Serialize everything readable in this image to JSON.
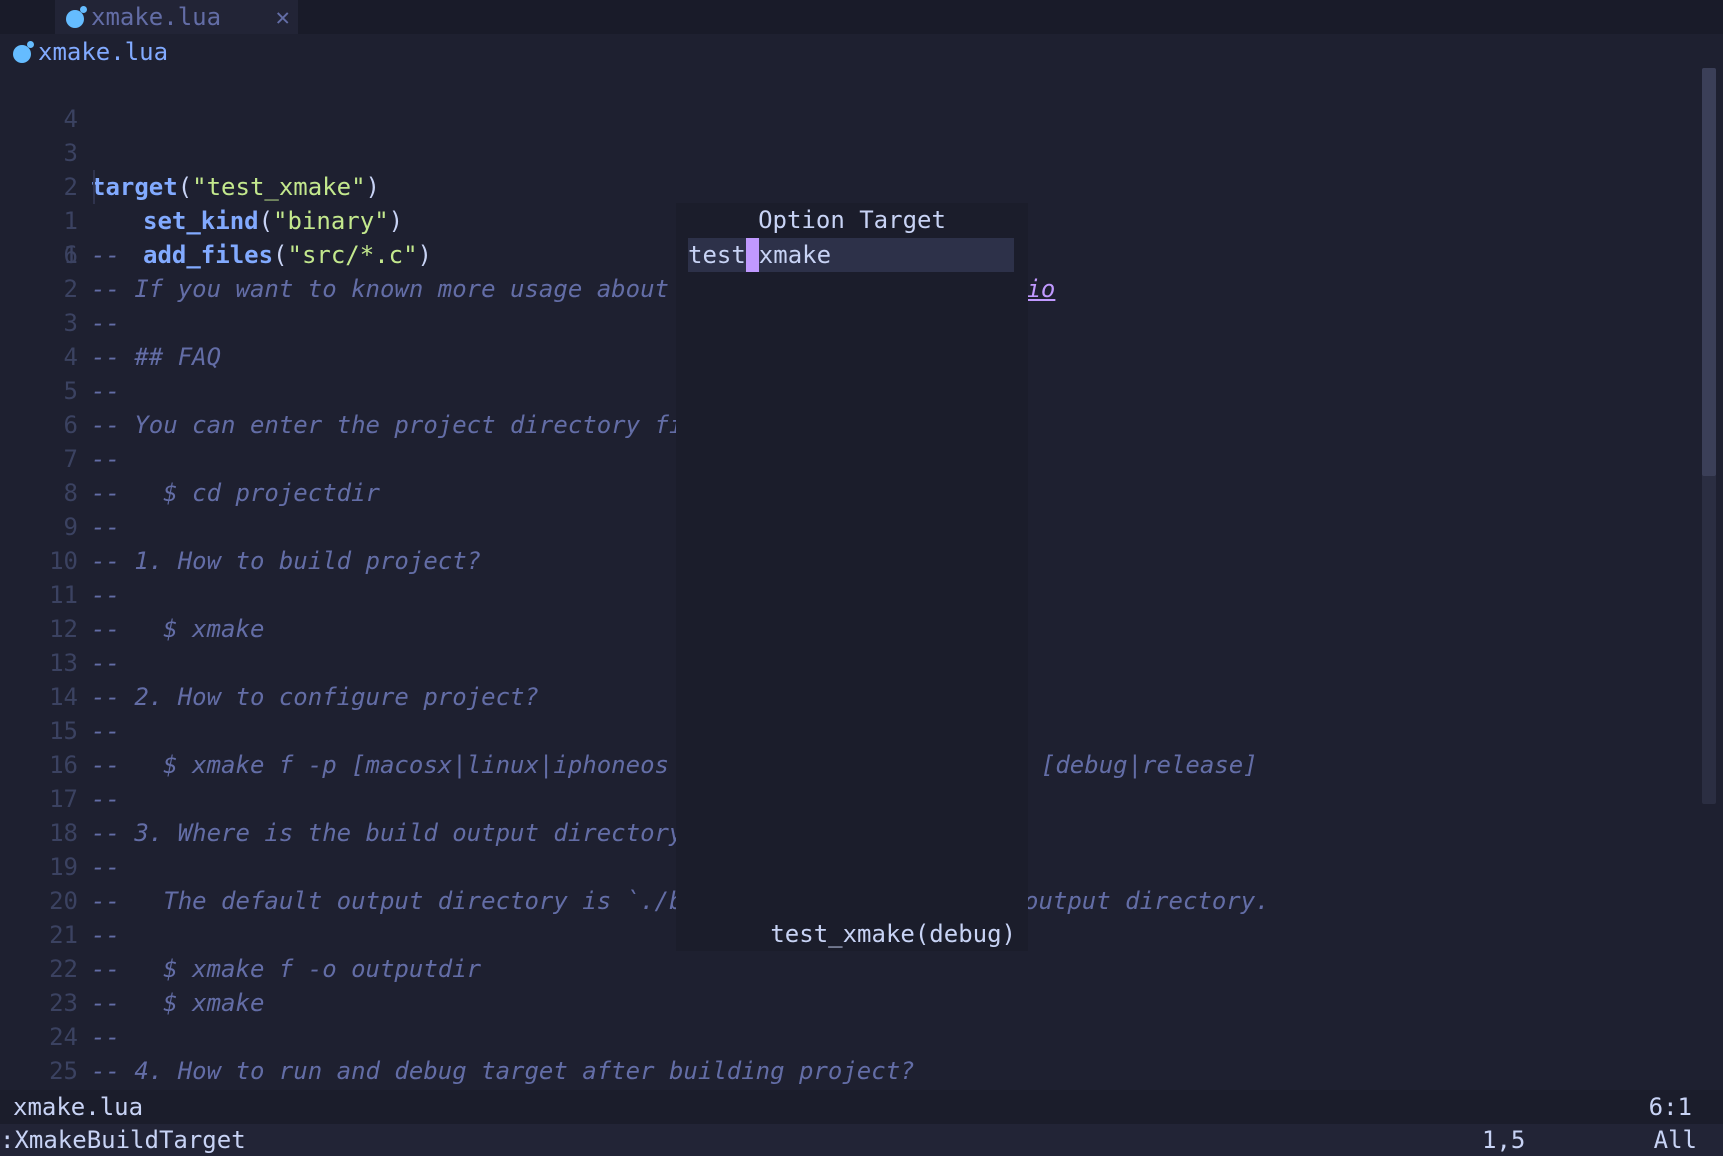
{
  "tab": {
    "title": "xmake.lua",
    "close": "✕"
  },
  "winbar": {
    "filename": "xmake.lua"
  },
  "code": {
    "line4": {
      "num": "4"
    },
    "line3": {
      "num": "3",
      "fn": "target",
      "open": "(",
      "str": "\"test_xmake\"",
      "close": ")"
    },
    "line2": {
      "num": "2",
      "fn": "set_kind",
      "open": "(",
      "str": "\"binary\"",
      "close": ")"
    },
    "line1": {
      "num": "1",
      "fn": "add_files",
      "open": "(",
      "str": "\"src/*.c\"",
      "close": ")"
    },
    "line6": {
      "num": "6"
    }
  },
  "comments": [
    {
      "num": "1",
      "text": "--"
    },
    {
      "num": "2",
      "text": "-- If you want to known more usage about xmak",
      "suffix": ".io"
    },
    {
      "num": "3",
      "text": "--"
    },
    {
      "num": "4",
      "text": "-- ## FAQ"
    },
    {
      "num": "5",
      "text": "--"
    },
    {
      "num": "6",
      "text": "-- You can enter the project directory firstl"
    },
    {
      "num": "7",
      "text": "--"
    },
    {
      "num": "8",
      "text": "--   $ cd projectdir"
    },
    {
      "num": "9",
      "text": "--"
    },
    {
      "num": "10",
      "text": "-- 1. How to build project?"
    },
    {
      "num": "11",
      "text": "--"
    },
    {
      "num": "12",
      "text": "--   $ xmake"
    },
    {
      "num": "13",
      "text": "--"
    },
    {
      "num": "14",
      "text": "-- 2. How to configure project?"
    },
    {
      "num": "15",
      "text": "--"
    },
    {
      "num": "16",
      "text": "--   $ xmake f -p [macosx|linux|iphoneos ..]",
      "suffix": "m [debug|release]"
    },
    {
      "num": "17",
      "text": "--"
    },
    {
      "num": "18",
      "text": "-- 3. Where is the build output directory?"
    },
    {
      "num": "19",
      "text": "--"
    },
    {
      "num": "20",
      "text": "--   The default output directory is `./build",
      "suffix": "output directory."
    },
    {
      "num": "21",
      "text": "--"
    },
    {
      "num": "22",
      "text": "--   $ xmake f -o outputdir"
    },
    {
      "num": "23",
      "text": "--   $ xmake"
    },
    {
      "num": "24",
      "text": "--"
    },
    {
      "num": "25",
      "text": "-- 4. How to run and debug target after building project?"
    }
  ],
  "popup": {
    "title": "Option Target",
    "input_before": "test",
    "input_cursor": "_",
    "input_after": "xmake",
    "footer": "test_xmake(debug)"
  },
  "statusline": {
    "filename": "xmake.lua",
    "position": "6:1"
  },
  "cmdline": {
    "command": ":XmakeBuildTarget",
    "ruler": "1,5",
    "scroll": "All"
  },
  "colors": {
    "background": "#1e2030",
    "function": "#82aaff",
    "string": "#c3e88d",
    "comment": "#636da6",
    "cursor": "#c099ff"
  }
}
